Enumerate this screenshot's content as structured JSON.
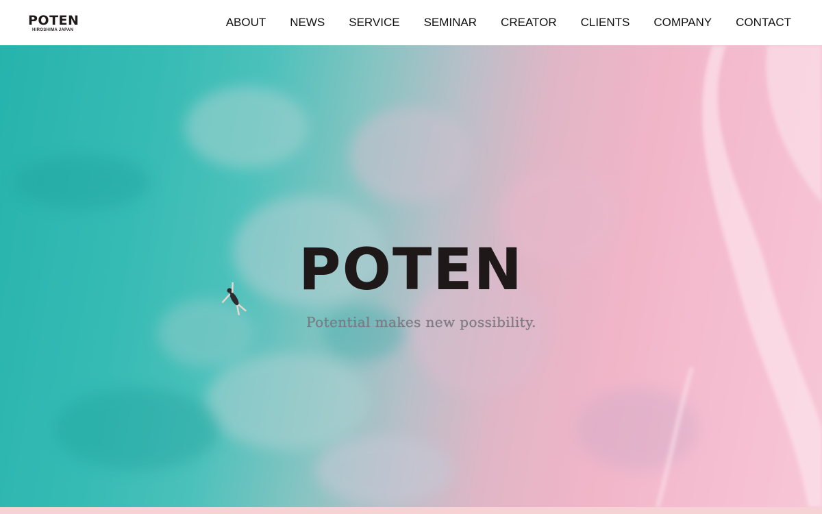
{
  "header": {
    "logo": {
      "name": "POTEN",
      "subtitle": "HIROSHIMA JAPAN"
    },
    "nav": [
      {
        "label": "ABOUT"
      },
      {
        "label": "NEWS"
      },
      {
        "label": "SERVICE"
      },
      {
        "label": "SEMINAR"
      },
      {
        "label": "CREATOR"
      },
      {
        "label": "CLIENTS"
      },
      {
        "label": "COMPANY"
      },
      {
        "label": "CONTACT"
      }
    ]
  },
  "hero": {
    "title": "POTEN",
    "tagline": "Potential makes new possibility.",
    "background": "aerial-beach-photo"
  },
  "colors": {
    "sea": "#27b3ad",
    "sand": "#f5bdd0",
    "text": "#1e1818",
    "strip": "#f6d2d5"
  }
}
